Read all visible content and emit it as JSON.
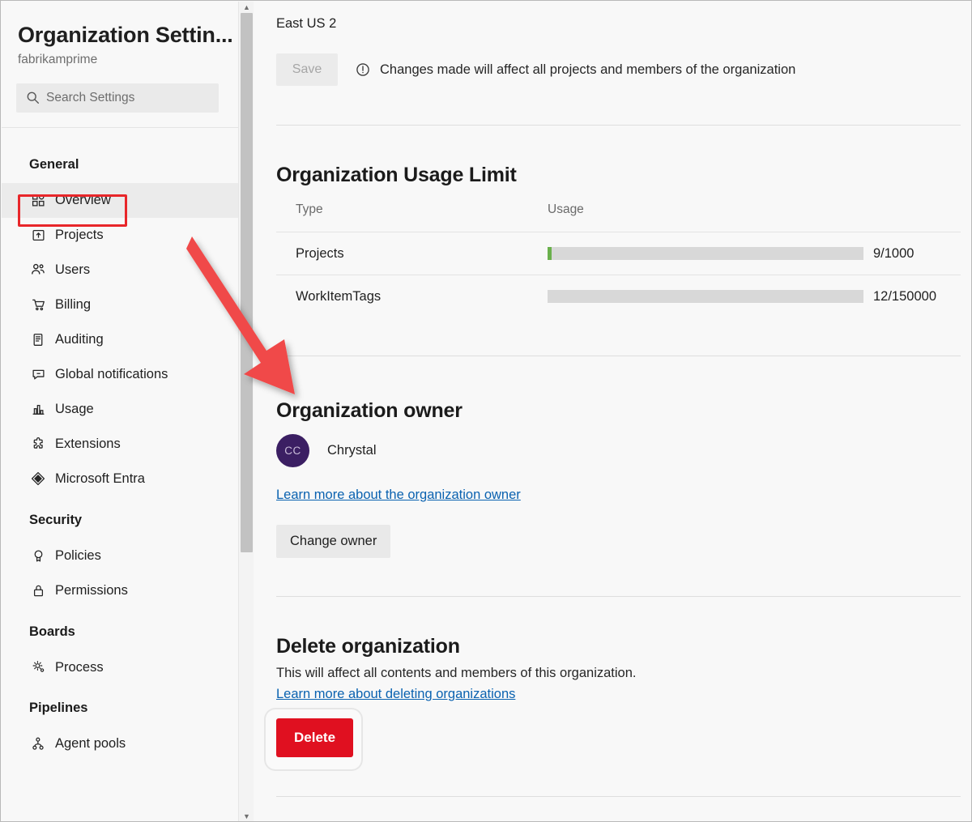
{
  "sidebar": {
    "title": "Organization Settin...",
    "subtitle": "fabrikamprime",
    "search": {
      "placeholder": "Search Settings",
      "value": "",
      "icon": "search-icon"
    },
    "groups": [
      {
        "title": "General",
        "items": [
          {
            "label": "Overview",
            "icon": "dashboard-grid-icon",
            "selected": true
          },
          {
            "label": "Projects",
            "icon": "project-upload-icon",
            "selected": false
          },
          {
            "label": "Users",
            "icon": "people-icon",
            "selected": false
          },
          {
            "label": "Billing",
            "icon": "shopping-cart-icon",
            "selected": false
          },
          {
            "label": "Auditing",
            "icon": "audit-log-icon",
            "selected": false
          },
          {
            "label": "Global notifications",
            "icon": "comment-bell-icon",
            "selected": false
          },
          {
            "label": "Usage",
            "icon": "bar-chart-icon",
            "selected": false
          },
          {
            "label": "Extensions",
            "icon": "puzzle-extension-icon",
            "selected": false
          },
          {
            "label": "Microsoft Entra",
            "icon": "entra-diamond-icon",
            "selected": false
          }
        ]
      },
      {
        "title": "Security",
        "items": [
          {
            "label": "Policies",
            "icon": "ribbon-badge-icon",
            "selected": false
          },
          {
            "label": "Permissions",
            "icon": "lock-icon",
            "selected": false
          }
        ]
      },
      {
        "title": "Boards",
        "items": [
          {
            "label": "Process",
            "icon": "gear-process-icon",
            "selected": false
          }
        ]
      },
      {
        "title": "Pipelines",
        "items": [
          {
            "label": "Agent pools",
            "icon": "agent-pool-icon",
            "selected": false
          }
        ]
      }
    ],
    "scrollbar": {
      "up_arrow": "▲",
      "down_arrow": "▼"
    }
  },
  "main": {
    "region_value": "East US 2",
    "save_label": "Save",
    "save_note": "Changes made will affect all projects and members of the organization",
    "usage": {
      "title": "Organization Usage Limit",
      "columns": [
        "Type",
        "Usage"
      ],
      "rows": [
        {
          "type": "Projects",
          "value": "9/1000",
          "used": 9,
          "limit": 1000,
          "percent": 1.3,
          "fill_color": "#6ab04c"
        },
        {
          "type": "WorkItemTags",
          "value": "12/150000",
          "used": 12,
          "limit": 150000,
          "percent": 0,
          "fill_color": "#6ab04c"
        }
      ]
    },
    "owner": {
      "title": "Organization owner",
      "avatar_initials": "CC",
      "avatar_color": "#3b1f63",
      "name": "Chrystal",
      "link": "Learn more about the organization owner",
      "change_button": "Change owner"
    },
    "delete": {
      "title": "Delete organization",
      "description": "This will affect all contents and members of this organization.",
      "link": "Learn more about deleting organizations",
      "button": "Delete",
      "button_color": "#e01020"
    }
  },
  "annotations": {
    "highlight_color": "#e8262a",
    "arrow_color": "#f04a48"
  }
}
